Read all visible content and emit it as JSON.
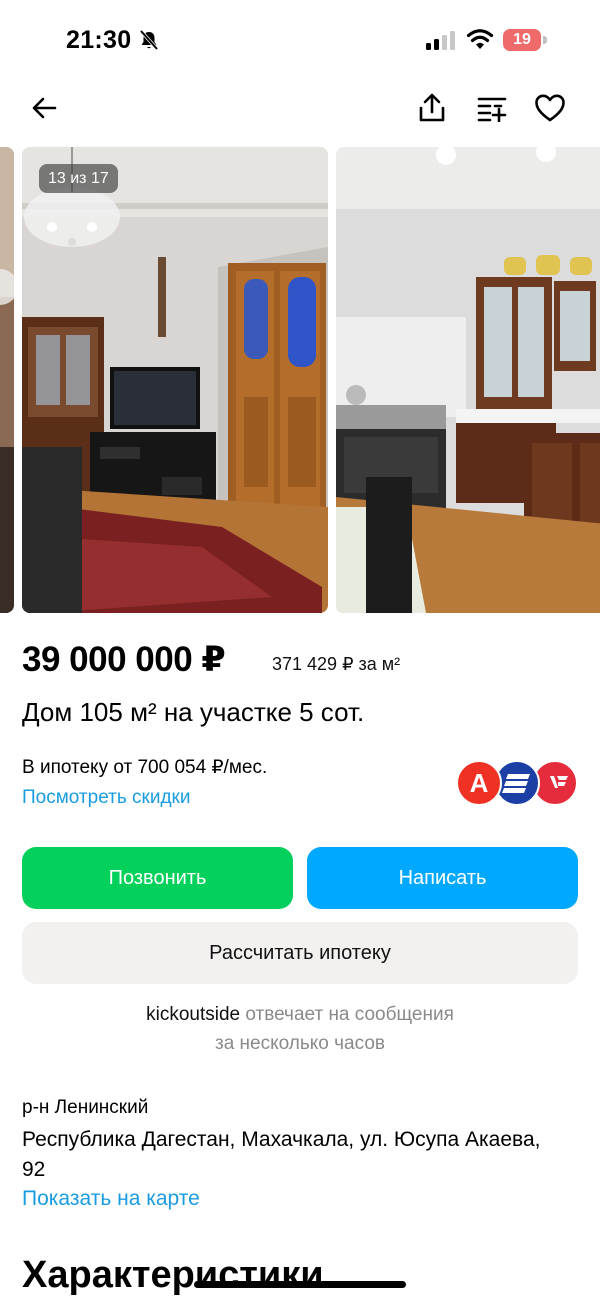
{
  "status_bar": {
    "time": "21:30",
    "battery_level": "19",
    "icons": [
      "bell-slash-icon",
      "cellular-signal-icon",
      "wifi-icon",
      "battery-icon"
    ]
  },
  "nav": {
    "icons": [
      "arrow-left-icon",
      "share-icon",
      "compare-list-icon",
      "heart-icon"
    ]
  },
  "gallery": {
    "counter": "13 из 17"
  },
  "listing": {
    "price": "39 000 000 ₽",
    "price_per_m2": "371 429 ₽ за м²",
    "title": "Дом 105 м² на участке 5 сот.",
    "mortgage_text": "В ипотеку от 700 054 ₽/мес.",
    "discounts_link": "Посмотреть скидки",
    "bank_logo_alfa": "А",
    "banks": [
      "alfa-bank-logo",
      "vtb-bank-logo",
      "bank-logo"
    ]
  },
  "actions": {
    "call": "Позвонить",
    "write": "Написать",
    "calc_mortgage": "Рассчитать ипотеку"
  },
  "seller": {
    "name": "kickoutside",
    "response_line1": " отвечает на сообщения",
    "response_line2": "за несколько часов"
  },
  "location": {
    "district": "р-н Ленинский",
    "address": "Республика Дагестан, Махачкала, ул. Юсупа Акаева, 92",
    "map_link": "Показать на карте"
  },
  "sections": {
    "characteristics": "Характеристики"
  },
  "colors": {
    "call_button": "#03d15b",
    "write_button": "#00a9ff",
    "link": "#1a9ce0",
    "battery": "#ef6a6a"
  }
}
